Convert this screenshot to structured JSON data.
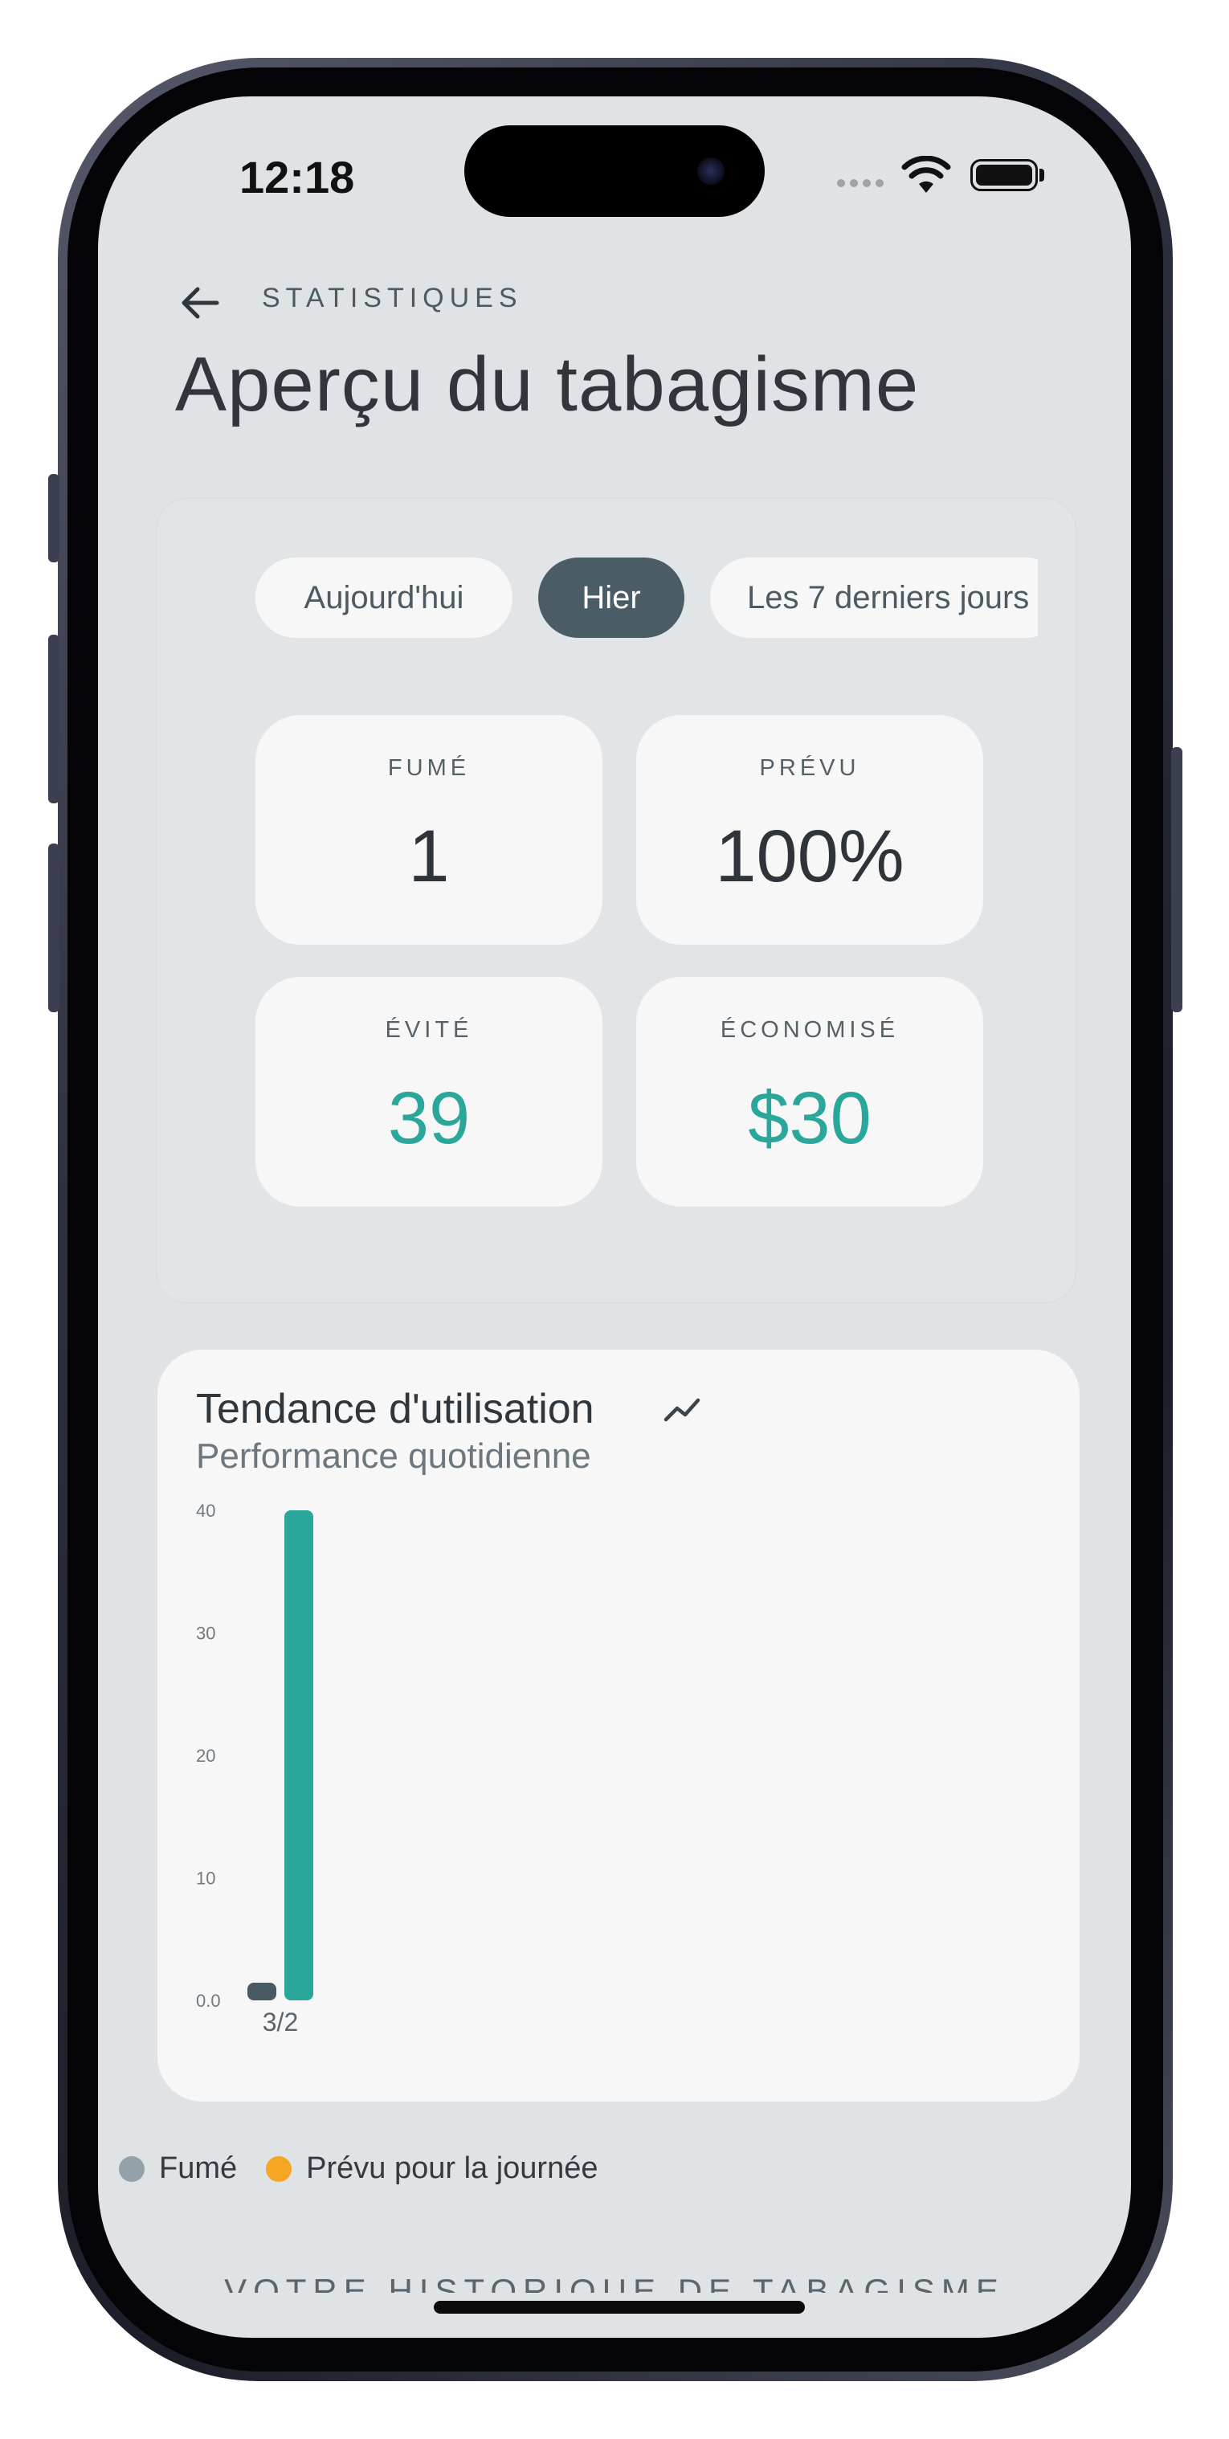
{
  "status_bar": {
    "time": "12:18",
    "icons": [
      "cellular-dots-icon",
      "wifi-icon",
      "battery-icon"
    ]
  },
  "header": {
    "back_icon": "arrow-left-icon",
    "eyebrow": "STATISTIQUES",
    "title": "Aperçu du tabagisme"
  },
  "period_tabs": [
    {
      "label": "Aujourd'hui",
      "active": false
    },
    {
      "label": "Hier",
      "active": true
    },
    {
      "label": "Les 7 derniers jours",
      "active": false
    }
  ],
  "stats": {
    "smoked": {
      "label": "FUMÉ",
      "value": "1"
    },
    "planned": {
      "label": "PRÉVU",
      "value": "100%"
    },
    "avoided": {
      "label": "ÉVITÉ",
      "value": "39"
    },
    "saved": {
      "label": "ÉCONOMISÉ",
      "value": "$30"
    }
  },
  "chart_card": {
    "title": "Tendance d'utilisation",
    "title_icon": "trend-line-icon",
    "subtitle": "Performance quotidienne"
  },
  "chart_data": {
    "type": "bar",
    "categories": [
      "3/2"
    ],
    "series": [
      {
        "name": "Fumé",
        "values": [
          1
        ],
        "color": "#4a5a63"
      },
      {
        "name": "",
        "values": [
          40
        ],
        "color": "#2aa79a"
      }
    ],
    "y_ticks": [
      "0.0",
      "10",
      "20",
      "30",
      "40"
    ],
    "ylim": [
      0,
      40
    ],
    "grid": false
  },
  "legend": [
    {
      "label": "Fumé",
      "color": "#94a1a8"
    },
    {
      "label": "Prévu pour la journée",
      "color": "#f5a623"
    }
  ],
  "history_heading": "VOTRE HISTORIQUE DE TABAGISME",
  "colors": {
    "accent_teal": "#2aa79a",
    "active_chip": "#4a5c66",
    "screen_bg": "#e0e3e6",
    "card_bg": "#f7f7f7"
  }
}
